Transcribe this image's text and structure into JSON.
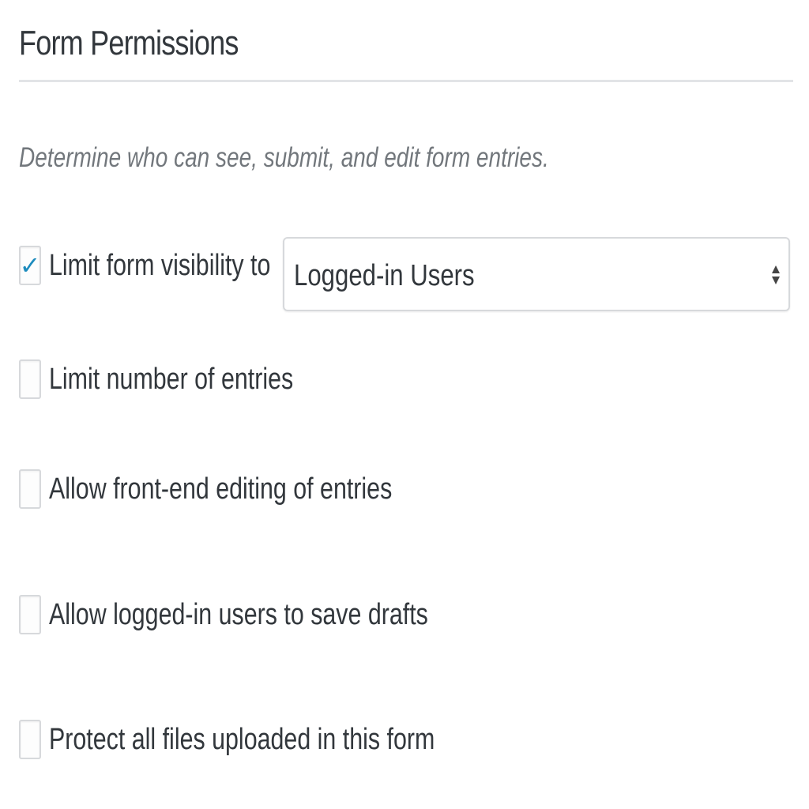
{
  "section": {
    "title": "Form Permissions",
    "description": "Determine who can see, submit, and edit form entries."
  },
  "options": [
    {
      "label": "Limit form visibility to",
      "checked": true
    },
    {
      "label": "Limit number of entries",
      "checked": false
    },
    {
      "label": "Allow front-end editing of entries",
      "checked": false
    },
    {
      "label": "Allow logged-in users to save drafts",
      "checked": false
    },
    {
      "label": "Protect all files uploaded in this form",
      "checked": false
    }
  ],
  "visibility_select": {
    "value": "Logged-in Users"
  },
  "colors": {
    "checkmark": "#1e8cbe",
    "divider": "#e2e4e7",
    "description_text": "#72777c"
  },
  "icons": {
    "check": "checkmark-icon",
    "select_arrows": "up-down-arrows-icon"
  }
}
